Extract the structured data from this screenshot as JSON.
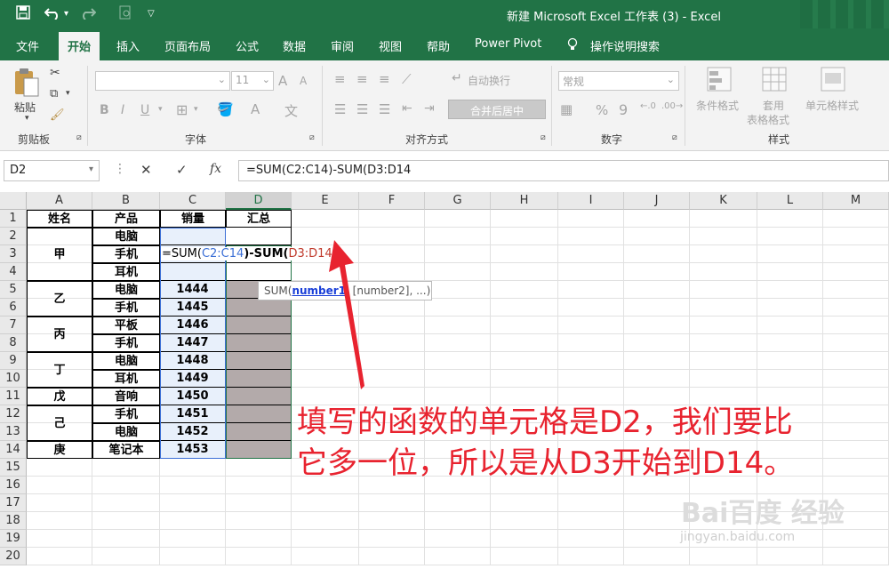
{
  "titlebar": {
    "title": "新建 Microsoft Excel 工作表 (3)  -  Excel",
    "save_icon": "save-icon",
    "undo_icon": "undo-icon",
    "redo_icon": "redo-icon"
  },
  "tabs": [
    "文件",
    "开始",
    "插入",
    "页面布局",
    "公式",
    "数据",
    "审阅",
    "视图",
    "帮助",
    "Power Pivot",
    "操作说明搜索"
  ],
  "active_tab": "开始",
  "ribbon": {
    "clipboard": {
      "paste": "粘贴",
      "group": "剪贴板"
    },
    "font": {
      "size": "11",
      "group": "字体",
      "bold": "B",
      "italic": "I",
      "underline": "U",
      "grow": "A",
      "shrink": "A"
    },
    "alignment": {
      "wrap": "自动换行",
      "merge": "合并后居中",
      "group": "对齐方式"
    },
    "number": {
      "format": "常规",
      "percent": "%",
      "comma": "9",
      "group": "数字"
    },
    "styles": {
      "conditional": "条件格式",
      "table1": "套用",
      "table2": "表格格式",
      "cell_styles": "单元格样式",
      "group": "样式"
    }
  },
  "formula_bar": {
    "name_box": "D2",
    "cancel": "✕",
    "enter": "✓",
    "fx": "fx",
    "formula": "=SUM(C2:C14)-SUM(D3:D14"
  },
  "columns": [
    "A",
    "B",
    "C",
    "D",
    "E",
    "F",
    "G",
    "H",
    "I",
    "J",
    "K",
    "L",
    "M"
  ],
  "rows": [
    "1",
    "2",
    "3",
    "4",
    "5",
    "6",
    "7",
    "8",
    "9",
    "10",
    "11",
    "12",
    "13",
    "14",
    "15",
    "16",
    "17",
    "18",
    "19",
    "20"
  ],
  "table": {
    "headers": [
      "姓名",
      "产品",
      "销量",
      "汇总"
    ],
    "names": [
      "甲",
      "乙",
      "丙",
      "丁",
      "戊",
      "己",
      "庚"
    ],
    "products": [
      "电脑",
      "手机",
      "耳机",
      "电脑",
      "手机",
      "平板",
      "手机",
      "电脑",
      "耳机",
      "音响",
      "手机",
      "电脑",
      "笔记本"
    ],
    "sales": [
      "",
      "",
      "",
      "1444",
      "1445",
      "1446",
      "1447",
      "1448",
      "1449",
      "1450",
      "1451",
      "1452",
      "1453"
    ]
  },
  "editing": {
    "prefix": "=SUM(",
    "ref1": "C2:C14",
    "mid": ")-SUM(",
    "ref2": "D3:D14",
    "ref1_color": "#3b6fd6",
    "ref2_color": "#c0392b"
  },
  "tooltip": {
    "fn": "SUM(",
    "arg1": "number1",
    "rest": ", [number2], ...)"
  },
  "annotation": {
    "line1": "填写的函数的单元格是D2，我们要比",
    "line2": "它多一位，所以是从D3开始到D14。",
    "color": "#e8232f"
  },
  "watermark": {
    "line1": "Bai百度 经验",
    "line2": "jingyan.baidu.com"
  },
  "colors": {
    "excel_green": "#217346",
    "selection_fill": "#b3aaaa"
  }
}
